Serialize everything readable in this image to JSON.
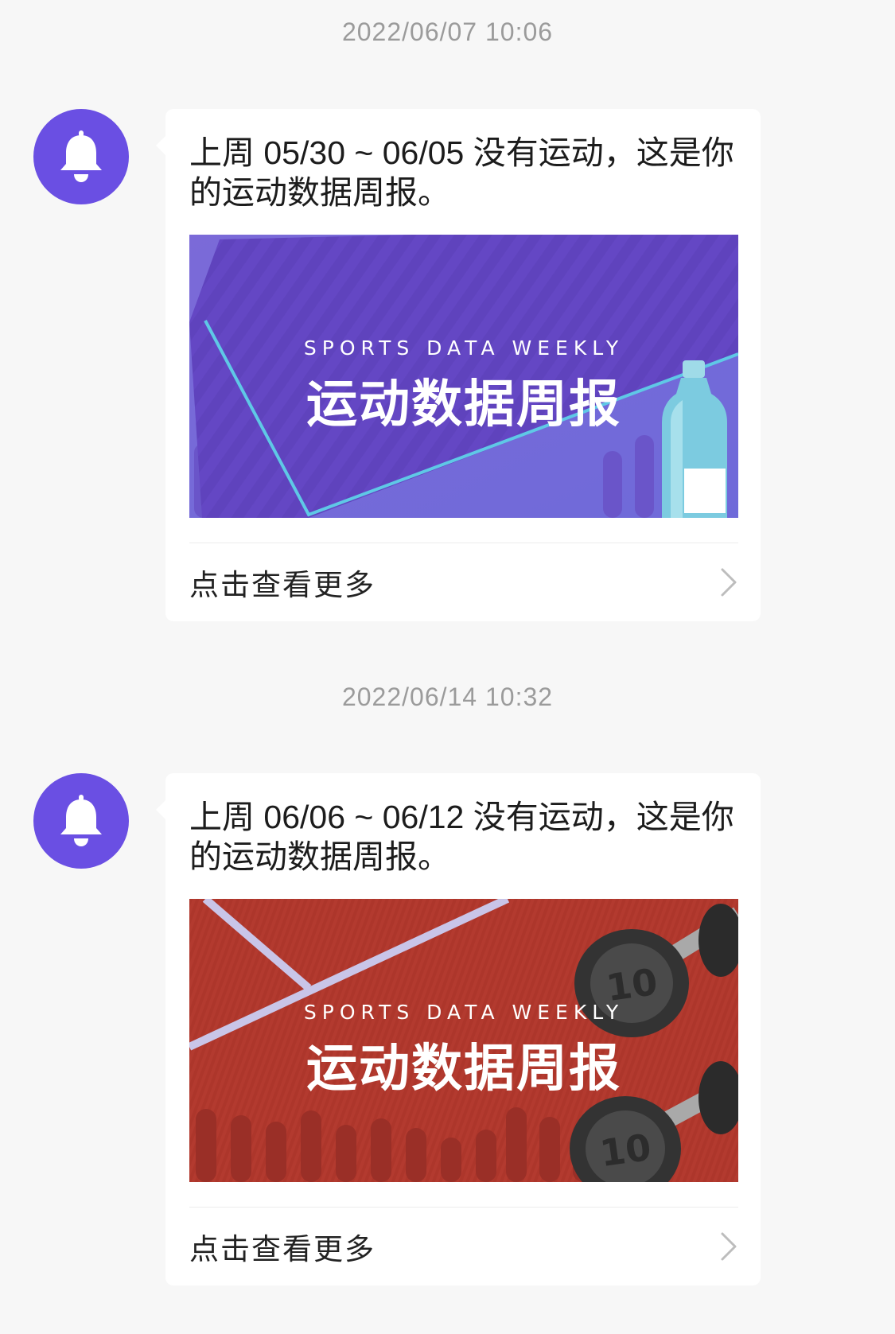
{
  "colors": {
    "accent": "#6a4fe3",
    "background": "#f7f7f7",
    "card": "#ffffff",
    "timestamp": "#9b9b9b"
  },
  "messages": [
    {
      "timestamp": "2022/06/07 10:06",
      "avatar_icon": "bell-icon",
      "text": "上周 05/30 ~ 06/05 没有运动，这是你的运动数据周报。",
      "banner": {
        "subtitle": "SPORTS DATA WEEKLY",
        "title": "运动数据周报",
        "theme": "purple",
        "theme_color": "#6a4ec8"
      },
      "more_label": "点击查看更多",
      "more_icon": "chevron-right-icon"
    },
    {
      "timestamp": "2022/06/14 10:32",
      "avatar_icon": "bell-icon",
      "text": "上周 06/06 ~ 06/12 没有运动，这是你的运动数据周报。",
      "banner": {
        "subtitle": "SPORTS DATA WEEKLY",
        "title": "运动数据周报",
        "theme": "red",
        "theme_color": "#b23a2e"
      },
      "more_label": "点击查看更多",
      "more_icon": "chevron-right-icon"
    }
  ]
}
